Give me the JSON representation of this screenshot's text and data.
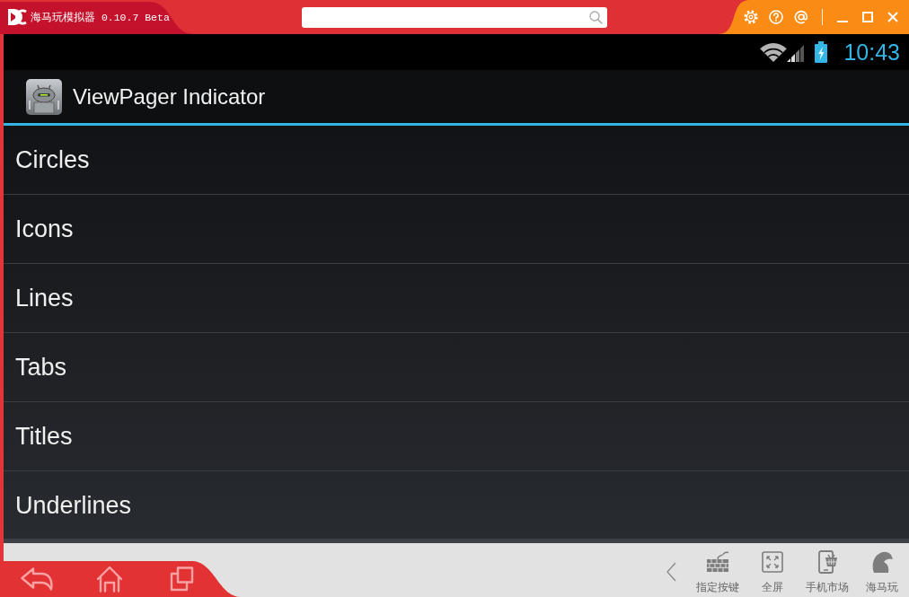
{
  "window": {
    "title": "海马玩模拟器 0.10.7 Beta"
  },
  "status_bar": {
    "time": "10:43"
  },
  "action_bar": {
    "title": "ViewPager Indicator"
  },
  "list": {
    "items": [
      {
        "label": "Circles"
      },
      {
        "label": "Icons"
      },
      {
        "label": "Lines"
      },
      {
        "label": "Tabs"
      },
      {
        "label": "Titles"
      },
      {
        "label": "Underlines"
      }
    ]
  },
  "toolbar": {
    "tools": [
      {
        "kind": "keymap",
        "label": "指定按键"
      },
      {
        "kind": "fullscreen",
        "label": "全屏"
      },
      {
        "kind": "market",
        "label": "手机市场"
      },
      {
        "kind": "brand",
        "label": "海马玩"
      }
    ]
  }
}
